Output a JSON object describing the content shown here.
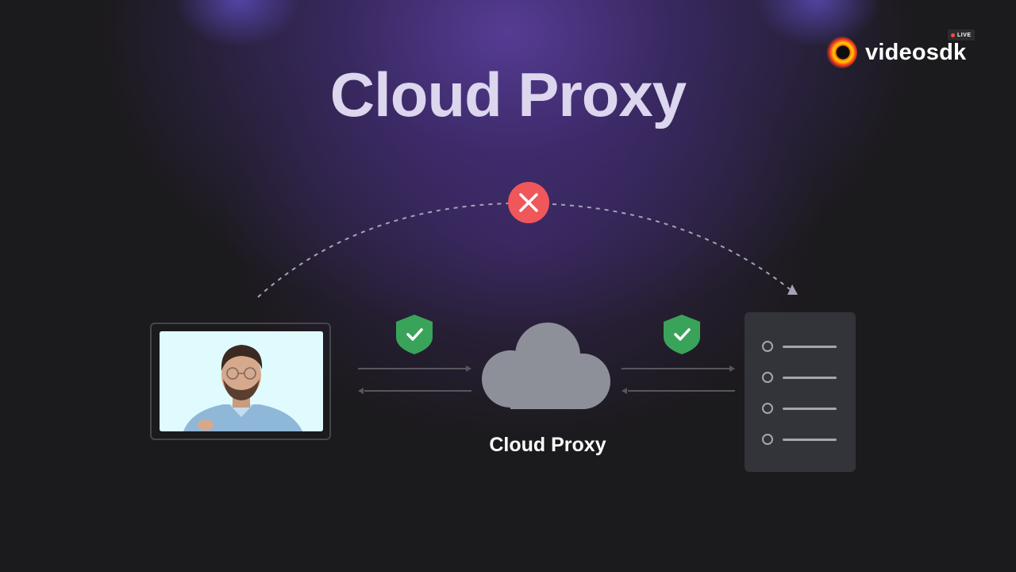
{
  "title": "Cloud Proxy",
  "brand": {
    "name": "videosdk",
    "live_badge": "LIVE"
  },
  "diagram": {
    "cloud_label": "Cloud Proxy",
    "direct_path_status": "blocked",
    "secure_links": [
      "client-to-proxy",
      "proxy-to-server"
    ],
    "server_rows": 4
  },
  "colors": {
    "background": "#1b1a1c",
    "title": "#dcd6ee",
    "glow": "#5a3fa0",
    "blocked": "#f0575a",
    "shield": "#3aa35a",
    "cloud": "#8e9099",
    "server": "#33343a"
  },
  "icons": [
    "blocked-x-icon",
    "shield-check-icon",
    "cloud-icon",
    "server-icon",
    "person-video-thumbnail"
  ]
}
